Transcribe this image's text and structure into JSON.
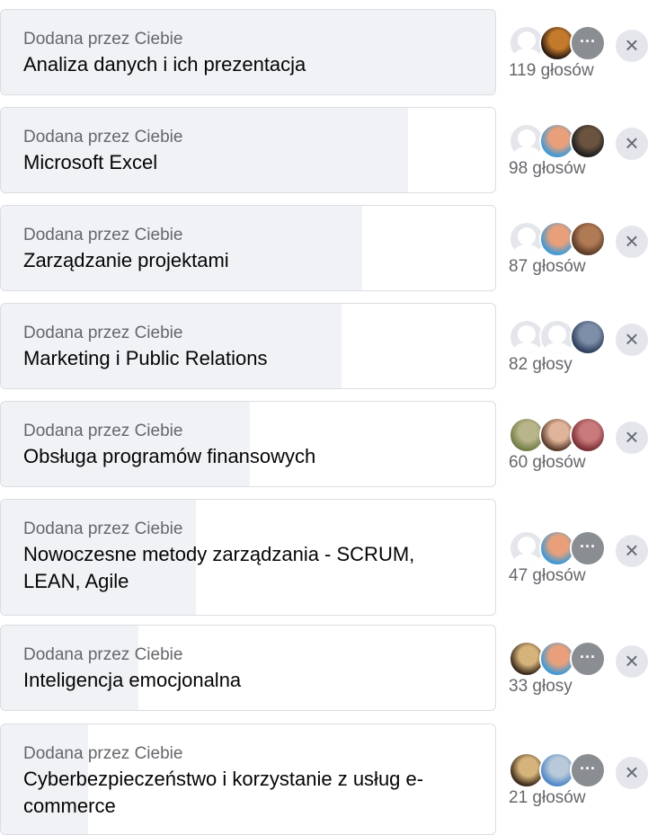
{
  "poll": {
    "options": [
      {
        "added_by": "Dodana przez Ciebie",
        "label": "Analiza danych i ich prezentacja",
        "votes": "119 głosów",
        "vote_number": 119,
        "voters": [
          {
            "kind": "placeholder-avatar"
          },
          {
            "kind": "photo",
            "colors": [
              "#2b1b12",
              "#c47a2c"
            ]
          },
          {
            "kind": "more",
            "icon": "more-dots-icon",
            "text": "···"
          }
        ]
      },
      {
        "added_by": "Dodana przez Ciebie",
        "label": "Microsoft Excel",
        "votes": "98 głosów",
        "vote_number": 98,
        "voters": [
          {
            "kind": "placeholder-avatar"
          },
          {
            "kind": "photo",
            "colors": [
              "#3e9ad6",
              "#e9a07a"
            ]
          },
          {
            "kind": "photo",
            "colors": [
              "#1d1d1d",
              "#6a5440"
            ]
          }
        ]
      },
      {
        "added_by": "Dodana przez Ciebie",
        "label": "Zarządzanie projektami",
        "votes": "87 głosów",
        "vote_number": 87,
        "voters": [
          {
            "kind": "placeholder-avatar"
          },
          {
            "kind": "photo",
            "colors": [
              "#3e9ad6",
              "#e9a07a"
            ]
          },
          {
            "kind": "photo",
            "colors": [
              "#5a3a26",
              "#b07a55"
            ]
          }
        ]
      },
      {
        "added_by": "Dodana przez Ciebie",
        "label": "Marketing i Public Relations",
        "votes": "82 głosy",
        "vote_number": 82,
        "voters": [
          {
            "kind": "placeholder-avatar"
          },
          {
            "kind": "placeholder-avatar"
          },
          {
            "kind": "photo",
            "colors": [
              "#2d3f5c",
              "#7d8fa8"
            ]
          }
        ]
      },
      {
        "added_by": "Dodana przez Ciebie",
        "label": "Obsługa programów finansowych",
        "votes": "60 głosów",
        "vote_number": 60,
        "voters": [
          {
            "kind": "photo",
            "colors": [
              "#6f7d45",
              "#b9b58a"
            ]
          },
          {
            "kind": "photo",
            "colors": [
              "#5a3a2a",
              "#e0b49a"
            ]
          },
          {
            "kind": "photo",
            "colors": [
              "#7a2d35",
              "#c97a7a"
            ]
          }
        ]
      },
      {
        "added_by": "Dodana przez Ciebie",
        "label": "Nowoczesne metody zarządzania - SCRUM, LEAN, Agile",
        "votes": "47 głosów",
        "vote_number": 47,
        "voters": [
          {
            "kind": "placeholder-avatar"
          },
          {
            "kind": "photo",
            "colors": [
              "#3e9ad6",
              "#e9a07a"
            ]
          },
          {
            "kind": "more",
            "icon": "more-dots-icon",
            "text": "···"
          }
        ]
      },
      {
        "added_by": "Dodana przez Ciebie",
        "label": "Inteligencja emocjonalna",
        "votes": "33 głosy",
        "vote_number": 33,
        "voters": [
          {
            "kind": "photo",
            "colors": [
              "#3a2a1c",
              "#d6b37a"
            ]
          },
          {
            "kind": "photo",
            "colors": [
              "#3e9ad6",
              "#e9a07a"
            ]
          },
          {
            "kind": "more",
            "icon": "more-dots-icon",
            "text": "···"
          }
        ]
      },
      {
        "added_by": "Dodana przez Ciebie",
        "label": "Cyberbezpieczeństwo i korzystanie z usług e-commerce",
        "votes": "21 głosów",
        "vote_number": 21,
        "voters": [
          {
            "kind": "photo",
            "colors": [
              "#3a2a1c",
              "#d6b37a"
            ]
          },
          {
            "kind": "photo",
            "colors": [
              "#4f87c7",
              "#b8c9d9"
            ]
          },
          {
            "kind": "more",
            "icon": "more-dots-icon",
            "text": "···"
          }
        ]
      }
    ],
    "remove_icon": "close-icon",
    "remove_symbol": "×"
  }
}
